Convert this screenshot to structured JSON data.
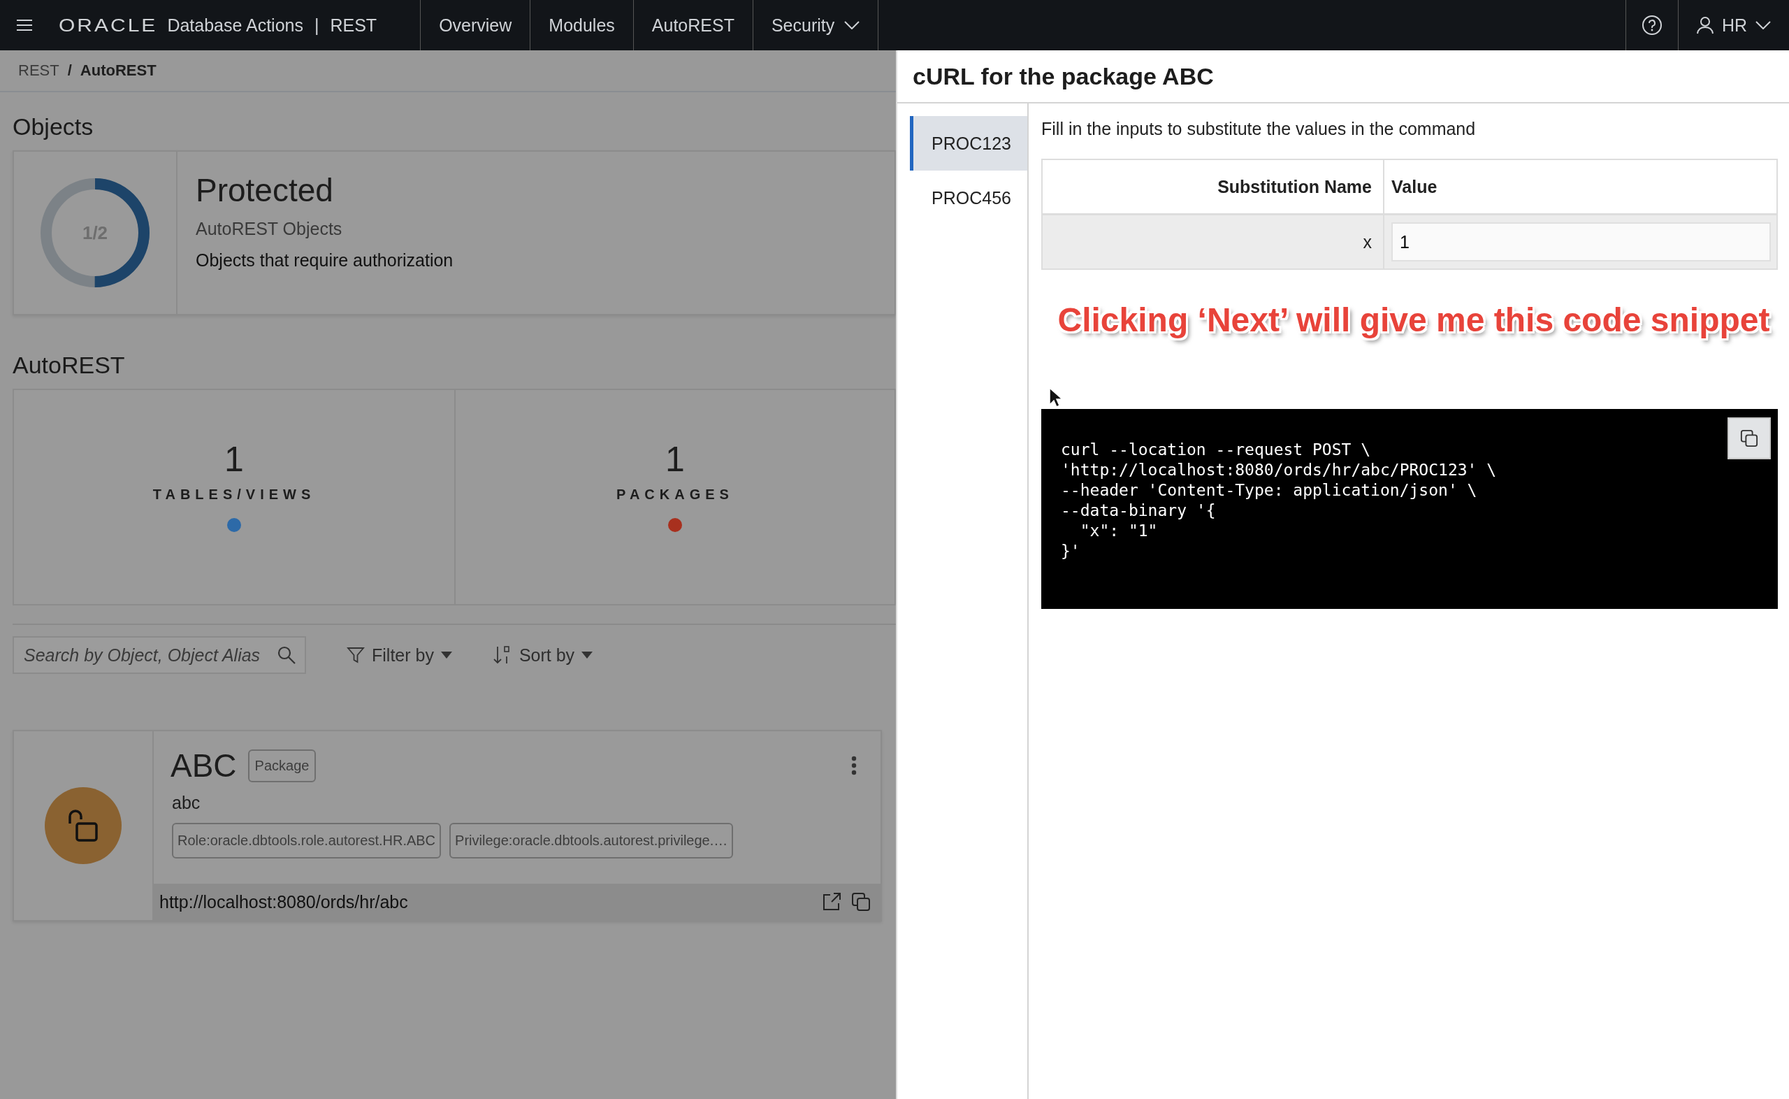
{
  "topbar": {
    "brand": "ORACLE",
    "app": "Database Actions",
    "separator": "|",
    "section": "REST",
    "nav": [
      {
        "label": "Overview",
        "dropdown": false
      },
      {
        "label": "Modules",
        "dropdown": false
      },
      {
        "label": "AutoREST",
        "dropdown": false
      },
      {
        "label": "Security",
        "dropdown": true
      }
    ],
    "user": "HR"
  },
  "breadcrumb": {
    "separator": "/",
    "items": [
      {
        "label": "REST",
        "current": false
      },
      {
        "label": "AutoREST",
        "current": true
      }
    ]
  },
  "objects": {
    "heading": "Objects",
    "donut": {
      "label": "1/2",
      "level": 0.5
    },
    "title": "Protected",
    "subtitle": "AutoREST Objects",
    "description": "Objects that require authorization"
  },
  "autorest": {
    "heading": "AutoREST",
    "counts": [
      {
        "value": "1",
        "label": "TABLES/VIEWS",
        "color": "#2d6aa8"
      },
      {
        "value": "1",
        "label": "PACKAGES",
        "color": "#a8301e"
      }
    ]
  },
  "toolbar": {
    "search": {
      "placeholder": "Search by Object, Object Alias"
    },
    "filter": "Filter by",
    "sort": "Sort by"
  },
  "items": [
    {
      "name": "ABC",
      "type": "Package",
      "alias": "abc",
      "tags": [
        "Role:oracle.dbtools.role.autorest.HR.ABC",
        "Privilege:oracle.dbtools.autorest.privilege.…"
      ],
      "url": "http://localhost:8080/ords/hr/abc"
    }
  ],
  "panel": {
    "title": "cURL for the package ABC",
    "tabs": [
      {
        "label": "PROC123",
        "selected": true
      },
      {
        "label": "PROC456",
        "selected": false
      }
    ],
    "instruction": "Fill in the inputs to substitute the values in the command",
    "table": {
      "columns": [
        "Substitution Name",
        "Value"
      ],
      "rows": [
        {
          "name": "x",
          "value": "1"
        }
      ]
    },
    "annotation": "Clicking ‘Next’ will give me this code snippet",
    "code": "curl --location --request POST \\\n'http://localhost:8080/ords/hr/abc/PROC123' \\\n--header 'Content-Type: application/json' \\\n--data-binary '{\n  \"x\": \"1\"\n}'"
  }
}
